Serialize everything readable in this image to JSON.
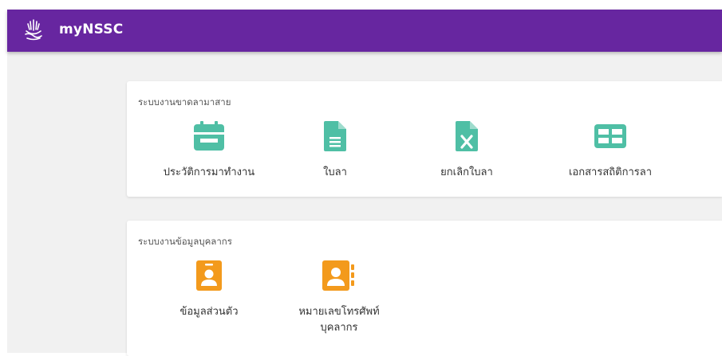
{
  "app": {
    "title": "myNSSC"
  },
  "colors": {
    "header": "#6726a0",
    "teal": "#4fbfa5",
    "orange": "#f39a1c"
  },
  "sections": [
    {
      "title": "ระบบงานขาดลามาสาย",
      "items": [
        {
          "label": "ประวัติการมาทำงาน",
          "icon": "calendar-icon"
        },
        {
          "label": "ใบลา",
          "icon": "document-icon"
        },
        {
          "label": "ยกเลิกใบลา",
          "icon": "excel-file-icon"
        },
        {
          "label": "เอกสารสถิติการลา",
          "icon": "table-icon"
        }
      ]
    },
    {
      "title": "ระบบงานข้อมูลบุคลากร",
      "items": [
        {
          "label": "ข้อมูลส่วนตัว",
          "icon": "id-badge-icon"
        },
        {
          "label_line1": "หมายเลขโทรศัพท์",
          "label_line2": "บุคลากร",
          "icon": "contact-book-icon"
        }
      ]
    }
  ]
}
